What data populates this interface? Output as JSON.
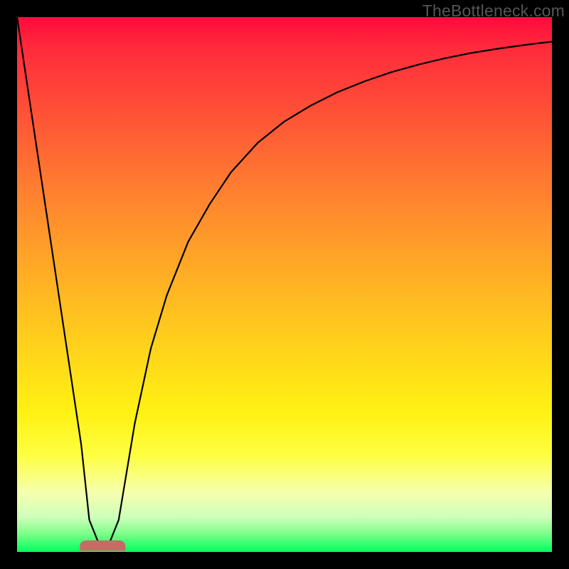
{
  "watermark": "TheBottleneck.com",
  "colors": {
    "background": "#000000",
    "curve": "#000000",
    "marker": "#c76b65",
    "watermark": "#595959"
  },
  "chart_data": {
    "type": "line",
    "title": "",
    "xlabel": "",
    "ylabel": "",
    "xlim": [
      0,
      100
    ],
    "ylim": [
      0,
      100
    ],
    "grid": false,
    "annotations": [],
    "series": [
      {
        "name": "bottleneck_curve",
        "x": [
          0,
          3,
          6,
          9,
          12,
          13.5,
          15.5,
          17,
          19,
          22,
          25,
          28,
          32,
          36,
          40,
          45,
          50,
          55,
          60,
          65,
          70,
          75,
          80,
          85,
          90,
          95,
          100
        ],
        "values": [
          100,
          80,
          60,
          40,
          20,
          6,
          1,
          1,
          6,
          24,
          38,
          48,
          58,
          65,
          71,
          76.5,
          80.5,
          83.5,
          86,
          88,
          89.7,
          91.1,
          92.3,
          93.3,
          94.1,
          94.8,
          95.4
        ]
      }
    ],
    "optimum_marker": {
      "x": 16,
      "y": 0.5,
      "width": 3
    },
    "gradient_stops": [
      {
        "pct": 0,
        "color": "#ff0a3c"
      },
      {
        "pct": 21,
        "color": "#ff5b35"
      },
      {
        "pct": 50,
        "color": "#ffb323"
      },
      {
        "pct": 74,
        "color": "#fff113"
      },
      {
        "pct": 89,
        "color": "#f5ffaf"
      },
      {
        "pct": 100,
        "color": "#00ff5e"
      }
    ]
  }
}
